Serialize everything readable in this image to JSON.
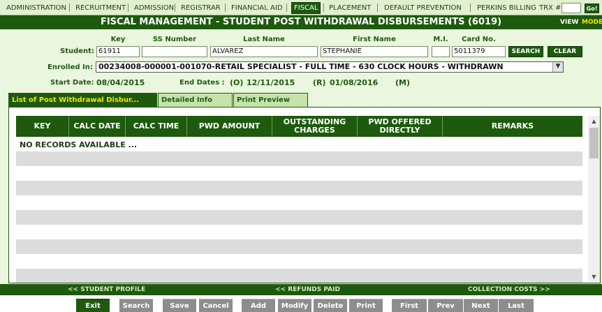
{
  "nav": {
    "items": [
      "ADMINISTRATION",
      "RECRUITMENT",
      "ADMISSION",
      "REGISTRAR",
      "FINANCIAL AID",
      "FISCAL",
      "PLACEMENT",
      "DEFAULT PREVENTION",
      "PERKINS BILLING"
    ],
    "active": "FISCAL",
    "trx_label": "TRX #:",
    "trx_value": "",
    "go_label": "Go!"
  },
  "title": "FISCAL MANAGEMENT - STUDENT POST WITHDRAWAL DISBURSEMENTS (6019)",
  "view_mode": {
    "view": "VIEW",
    "mode": "MODE"
  },
  "student": {
    "headers": {
      "key": "Key",
      "ss": "SS Number",
      "last": "Last Name",
      "first": "First Name",
      "mi": "M.I.",
      "card": "Card No."
    },
    "label": "Student:",
    "key": "61911",
    "ss_number": "",
    "last_name": "ALVAREZ",
    "first_name": "STEPHANIE",
    "mi": "",
    "card_no": "5011379",
    "search_label": "SEARCH",
    "clear_label": "CLEAR"
  },
  "enrolled": {
    "label": "Enrolled In:",
    "value": "00234008-000001-001070-RETAIL SPECIALIST - FULL TIME - 630 CLOCK HOURS - WITHDRAWN"
  },
  "dates": {
    "start_label": "Start Date:",
    "start_value": "08/04/2015",
    "end_label": "End Dates :",
    "o_label": "(O)",
    "o_value": "12/11/2015",
    "r_label": "(R)",
    "r_value": "01/08/2016",
    "m_label": "(M)"
  },
  "tabs": [
    "List of Post Withdrawal Disbur...",
    "Detailed Info",
    "Print Preview"
  ],
  "grid": {
    "columns": [
      "KEY",
      "CALC DATE",
      "CALC TIME",
      "PWD AMOUNT",
      "OUTSTANDING CHARGES",
      "PWD OFFERED DIRECTLY",
      "REMARKS"
    ],
    "no_records": "NO RECORDS AVAILABLE ..."
  },
  "links": {
    "student_profile": "<< STUDENT PROFILE",
    "refunds_paid": "<< REFUNDS PAID",
    "collection_costs": "COLLECTION COSTS >>"
  },
  "toolbar": [
    "Exit",
    "Search",
    "Save",
    "Cancel",
    "Add",
    "Modify",
    "Delete",
    "Print",
    "First",
    "Prev",
    "Next",
    "Last"
  ],
  "colors": {
    "primary": "#1d5a0d",
    "panel": "#eaf6de",
    "tab_active_text": "#f7e300",
    "mode_text": "#f7e300"
  }
}
